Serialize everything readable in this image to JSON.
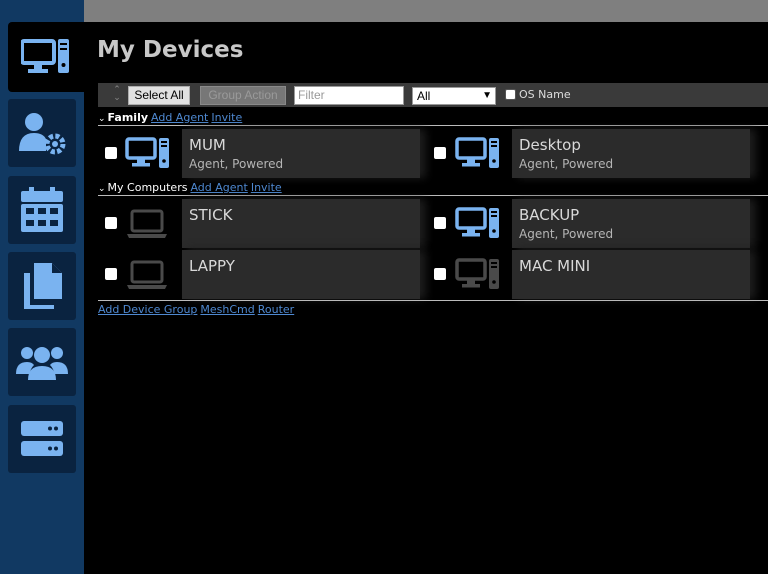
{
  "sidebar": {
    "items": [
      {
        "icon": "desktop-icon"
      },
      {
        "icon": "user-settings-icon"
      },
      {
        "icon": "calendar-icon"
      },
      {
        "icon": "files-icon"
      },
      {
        "icon": "users-icon"
      },
      {
        "icon": "server-icon"
      }
    ]
  },
  "page": {
    "title": "My Devices"
  },
  "toolbar": {
    "select_all_label": "Select All",
    "group_action_label": "Group Action",
    "filter_placeholder": "Filter",
    "filter_select_value": "All",
    "os_name_label": "OS Name"
  },
  "groups": [
    {
      "name": "Family",
      "add_agent_label": "Add Agent",
      "invite_label": "Invite",
      "devices": [
        {
          "name": "MUM",
          "status": "Agent, Powered",
          "icon": "desktop-icon"
        },
        {
          "name": "Desktop",
          "status": "Agent, Powered",
          "icon": "desktop-icon"
        }
      ]
    },
    {
      "name": "My Computers",
      "add_agent_label": "Add Agent",
      "invite_label": "Invite",
      "devices": [
        {
          "name": "STICK",
          "status": "",
          "icon": "laptop-icon"
        },
        {
          "name": "BACKUP",
          "status": "Agent, Powered",
          "icon": "desktop-icon"
        },
        {
          "name": "LAPPY",
          "status": "",
          "icon": "laptop-icon"
        },
        {
          "name": "MAC MINI",
          "status": "",
          "icon": "desktop-icon"
        }
      ]
    }
  ],
  "footer": {
    "add_device_group_label": "Add Device Group",
    "meshcmd_label": "MeshCmd",
    "router_label": "Router"
  },
  "colors": {
    "sidebar_bg": "#113962",
    "accent_blue": "#7ab3f0",
    "link_blue": "#4f89d1",
    "offline_gray": "#4a4a4a"
  }
}
